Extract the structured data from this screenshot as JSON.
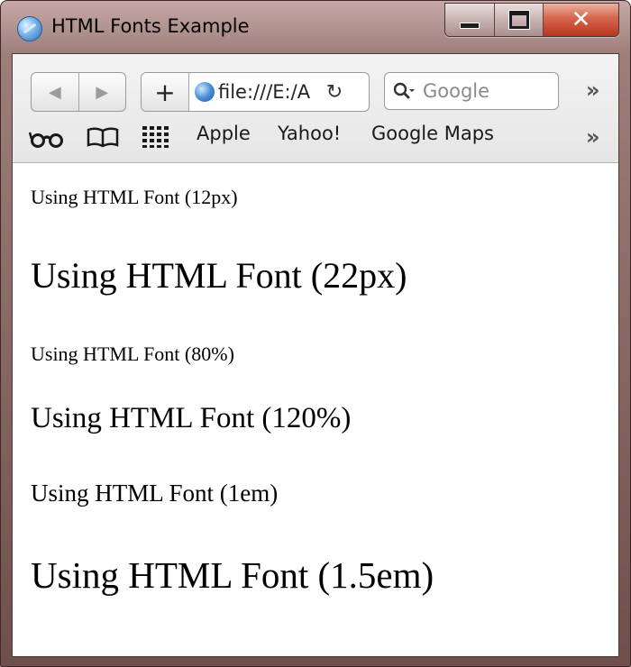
{
  "window": {
    "title": "HTML Fonts Example",
    "close_glyph": "✕"
  },
  "toolbar": {
    "back_glyph": "◀",
    "forward_glyph": "▶",
    "add_glyph": "+",
    "address_value": "file:///E:/A",
    "reload_glyph": "↻",
    "search_placeholder": "Google",
    "more_glyph": "»"
  },
  "bookmarks": {
    "reading_list_icon": "glasses-icon",
    "bookmarks_icon": "open-book-icon",
    "top_sites_icon": "grid-icon",
    "items": [
      "Apple",
      "Yahoo!",
      "Google Maps"
    ],
    "more_glyph": "»"
  },
  "content": {
    "lines": [
      "Using HTML Font (12px)",
      "Using HTML Font (22px)",
      "Using HTML Font (80%)",
      "Using HTML Font (120%)",
      "Using HTML Font (1em)",
      "Using HTML Font (1.5em)"
    ]
  }
}
